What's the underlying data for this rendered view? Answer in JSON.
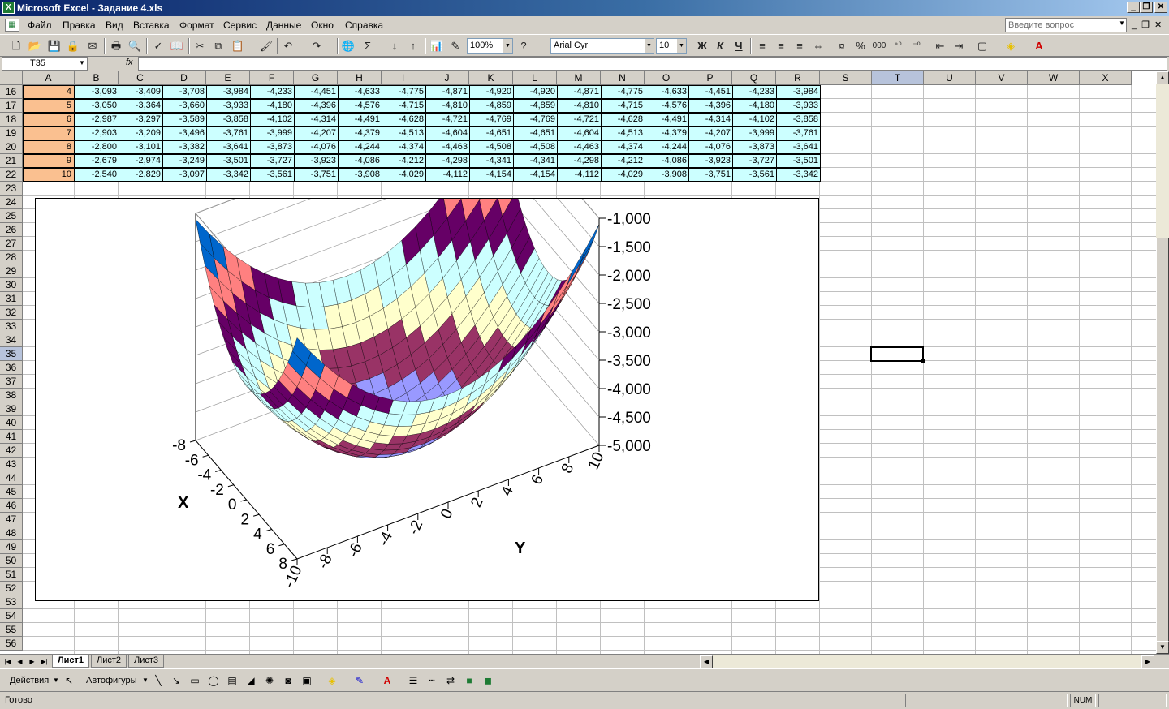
{
  "window": {
    "title": "Microsoft Excel - Задание 4.xls",
    "icon": "excel-icon"
  },
  "menu": {
    "items": [
      "Файл",
      "Правка",
      "Вид",
      "Вставка",
      "Формат",
      "Сервис",
      "Данные",
      "Окно",
      "Справка"
    ],
    "ask_placeholder": "Введите вопрос"
  },
  "toolbar": {
    "zoom": "100%",
    "font": "Arial Cyr",
    "font_size": "10",
    "bold": "Ж",
    "italic": "К",
    "underline": "Ч",
    "percent": "%",
    "thousands": "000"
  },
  "formula_bar": {
    "name_box": "T35",
    "fx": "fx",
    "value": ""
  },
  "grid": {
    "columns": [
      "A",
      "B",
      "C",
      "D",
      "E",
      "F",
      "G",
      "H",
      "I",
      "J",
      "K",
      "L",
      "M",
      "N",
      "O",
      "P",
      "Q",
      "R",
      "S",
      "T",
      "U",
      "V",
      "W",
      "X"
    ],
    "active_column": "T",
    "row_numbers": [
      "16",
      "17",
      "18",
      "19",
      "20",
      "21",
      "22",
      "23",
      "24",
      "25",
      "26",
      "27",
      "28",
      "29",
      "30",
      "31",
      "32",
      "33",
      "34",
      "35",
      "36",
      "37",
      "38",
      "39",
      "40",
      "41",
      "42",
      "43",
      "44",
      "45",
      "46",
      "47",
      "48",
      "49",
      "50",
      "51",
      "52",
      "53",
      "54",
      "55",
      "56"
    ],
    "active_row": "35",
    "data_rows": [
      {
        "a": "4",
        "values": [
          "-3,093",
          "-3,409",
          "-3,708",
          "-3,984",
          "-4,233",
          "-4,451",
          "-4,633",
          "-4,775",
          "-4,871",
          "-4,920",
          "-4,920",
          "-4,871",
          "-4,775",
          "-4,633",
          "-4,451",
          "-4,233",
          "-3,984"
        ]
      },
      {
        "a": "5",
        "values": [
          "-3,050",
          "-3,364",
          "-3,660",
          "-3,933",
          "-4,180",
          "-4,396",
          "-4,576",
          "-4,715",
          "-4,810",
          "-4,859",
          "-4,859",
          "-4,810",
          "-4,715",
          "-4,576",
          "-4,396",
          "-4,180",
          "-3,933"
        ]
      },
      {
        "a": "6",
        "values": [
          "-2,987",
          "-3,297",
          "-3,589",
          "-3,858",
          "-4,102",
          "-4,314",
          "-4,491",
          "-4,628",
          "-4,721",
          "-4,769",
          "-4,769",
          "-4,721",
          "-4,628",
          "-4,491",
          "-4,314",
          "-4,102",
          "-3,858"
        ]
      },
      {
        "a": "7",
        "values": [
          "-2,903",
          "-3,209",
          "-3,496",
          "-3,761",
          "-3,999",
          "-4,207",
          "-4,379",
          "-4,513",
          "-4,604",
          "-4,651",
          "-4,651",
          "-4,604",
          "-4,513",
          "-4,379",
          "-4,207",
          "-3,999",
          "-3,761"
        ]
      },
      {
        "a": "8",
        "values": [
          "-2,800",
          "-3,101",
          "-3,382",
          "-3,641",
          "-3,873",
          "-4,076",
          "-4,244",
          "-4,374",
          "-4,463",
          "-4,508",
          "-4,508",
          "-4,463",
          "-4,374",
          "-4,244",
          "-4,076",
          "-3,873",
          "-3,641"
        ]
      },
      {
        "a": "9",
        "values": [
          "-2,679",
          "-2,974",
          "-3,249",
          "-3,501",
          "-3,727",
          "-3,923",
          "-4,086",
          "-4,212",
          "-4,298",
          "-4,341",
          "-4,341",
          "-4,298",
          "-4,212",
          "-4,086",
          "-3,923",
          "-3,727",
          "-3,501"
        ]
      },
      {
        "a": "10",
        "values": [
          "-2,540",
          "-2,829",
          "-3,097",
          "-3,342",
          "-3,561",
          "-3,751",
          "-3,908",
          "-4,029",
          "-4,112",
          "-4,154",
          "-4,154",
          "-4,112",
          "-4,029",
          "-3,908",
          "-3,751",
          "-3,561",
          "-3,342"
        ]
      }
    ]
  },
  "chart": {
    "z_ticks": [
      "-1,000",
      "-1,500",
      "-2,000",
      "-2,500",
      "-3,000",
      "-3,500",
      "-4,000",
      "-4,500",
      "-5,000"
    ],
    "x_ticks": [
      "-8",
      "-6",
      "-4",
      "-2",
      "0",
      "2",
      "4",
      "6",
      "8"
    ],
    "y_ticks": [
      "-10",
      "-8",
      "-6",
      "-4",
      "-2",
      "0",
      "2",
      "4",
      "6",
      "8",
      "10"
    ],
    "x_label": "X",
    "y_label": "Y",
    "band_colors": [
      "#9999ff",
      "#993366",
      "#ffffcc",
      "#ccffff",
      "#660066",
      "#ff8080",
      "#0066cc"
    ]
  },
  "chart_data": {
    "type": "surface",
    "zlim": [
      -5,
      -1
    ],
    "xlim": [
      -8,
      8
    ],
    "ylim": [
      -10,
      10
    ],
    "xlabel": "X",
    "ylabel": "Y",
    "z_min": "-4,920"
  },
  "sheets": {
    "tabs": [
      "Лист1",
      "Лист2",
      "Лист3"
    ],
    "active": "Лист1"
  },
  "drawing": {
    "actions": "Действия",
    "autoshapes": "Автофигуры"
  },
  "status": {
    "text": "Готово",
    "num": "NUM"
  }
}
